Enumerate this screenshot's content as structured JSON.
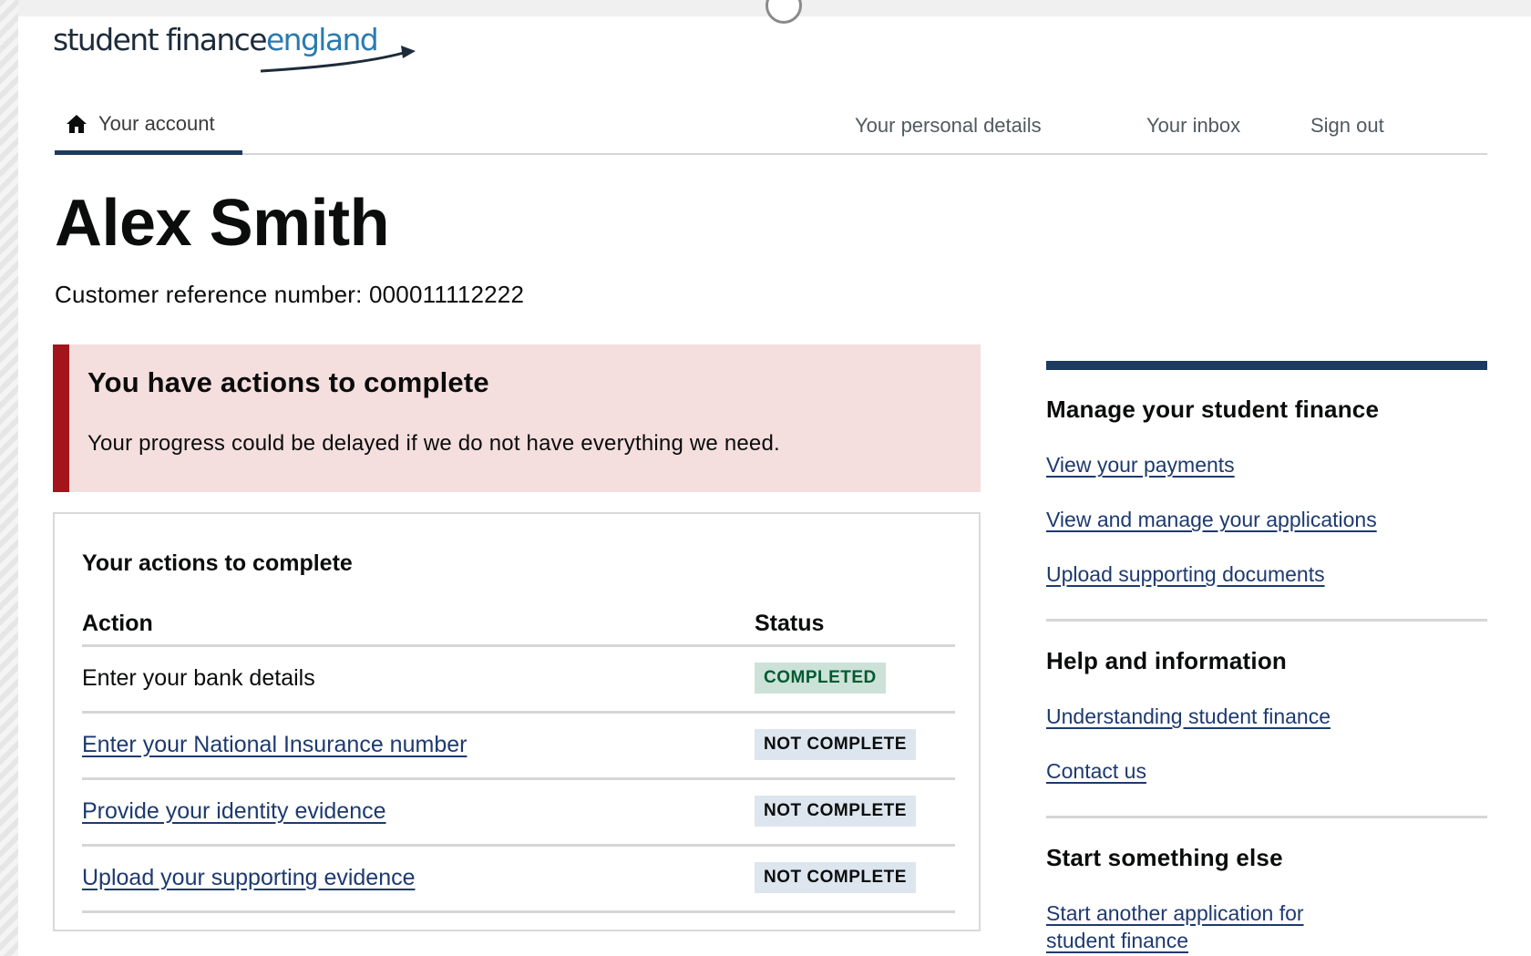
{
  "logo": {
    "word1": "student finance",
    "word2": "england"
  },
  "nav": {
    "home_label": "Your account",
    "links": [
      "Your personal details",
      "Your inbox",
      "Sign out"
    ]
  },
  "user": {
    "name": "Alex Smith",
    "crn": "Customer reference number: 000011112222"
  },
  "alert": {
    "title": "You have actions to complete",
    "body": "Your progress could be delayed if we do not have everything we need."
  },
  "actions": {
    "title": "Your actions to complete",
    "col_action": "Action",
    "col_status": "Status",
    "rows": [
      {
        "action": "Enter your bank details",
        "status": "COMPLETED"
      },
      {
        "action": "Enter your National Insurance number",
        "status": "NOT COMPLETE"
      },
      {
        "action": "Provide your identity evidence",
        "status": "NOT COMPLETE"
      },
      {
        "action": "Upload your supporting evidence",
        "status": "NOT COMPLETE"
      }
    ]
  },
  "sidebar": {
    "manage": {
      "heading": "Manage your student finance",
      "links": [
        "View your payments",
        "View and manage your applications",
        "Upload supporting documents"
      ]
    },
    "help": {
      "heading": "Help and information",
      "links": [
        "Understanding student finance",
        "Contact us"
      ]
    },
    "start": {
      "heading": "Start something else",
      "links": [
        "Start another application for student finance"
      ]
    }
  },
  "colors": {
    "brand_navy": "#1d3a5f",
    "alert_red": "#a4151b",
    "alert_bg": "#f4dede",
    "completed_bg": "#cce2d8",
    "not_complete_bg": "#dde6ef"
  }
}
